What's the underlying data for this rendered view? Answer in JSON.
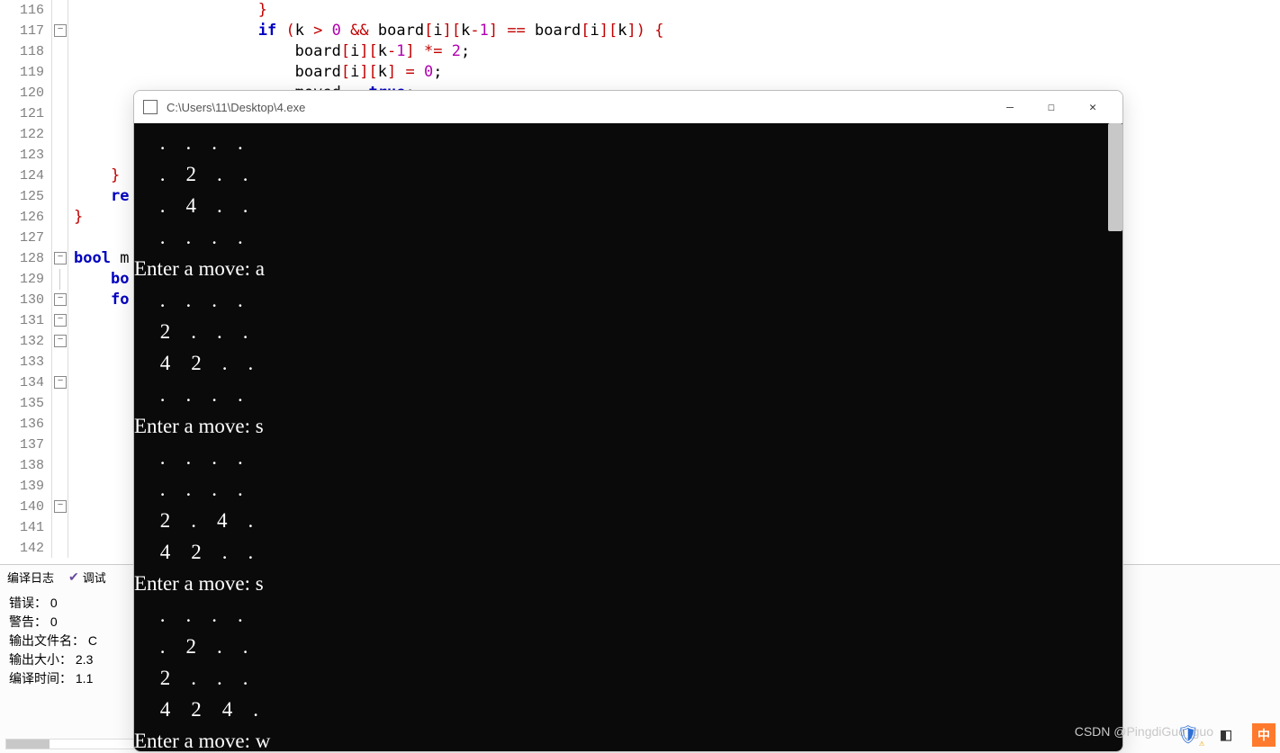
{
  "gutter": {
    "start": 116,
    "end": 142
  },
  "code_lines": [
    {
      "indent": 20,
      "html": "<span class='br'>}</span>"
    },
    {
      "indent": 20,
      "html": "<span class='kw'>if</span> <span class='br'>(</span>k <span class='op'>&gt;</span> <span class='num'>0</span> <span class='op'>&amp;&amp;</span> board<span class='br'>[</span>i<span class='br'>][</span>k<span class='op'>-</span><span class='num'>1</span><span class='br'>]</span> <span class='op'>==</span> board<span class='br'>[</span>i<span class='br'>][</span>k<span class='br'>]</span><span class='br'>)</span> <span class='br'>{</span>"
    },
    {
      "indent": 24,
      "html": "board<span class='br'>[</span>i<span class='br'>][</span>k<span class='op'>-</span><span class='num'>1</span><span class='br'>]</span> <span class='op'>*=</span> <span class='num'>2</span>;"
    },
    {
      "indent": 24,
      "html": "board<span class='br'>[</span>i<span class='br'>][</span>k<span class='br'>]</span> <span class='op'>=</span> <span class='num'>0</span>;"
    },
    {
      "indent": 24,
      "html": "moved <span class='op'>=</span> <span class='bool'>true</span>;"
    },
    {
      "indent": 0,
      "html": ""
    },
    {
      "indent": 0,
      "html": ""
    },
    {
      "indent": 0,
      "html": ""
    },
    {
      "indent": 4,
      "html": "<span class='br'>}</span>"
    },
    {
      "indent": 4,
      "html": "<span class='kw'>re</span>"
    },
    {
      "indent": 0,
      "html": "<span class='br'>}</span>"
    },
    {
      "indent": 0,
      "html": ""
    },
    {
      "indent": 0,
      "html": "<span class='kw'>bool</span> m"
    },
    {
      "indent": 4,
      "html": "<span class='kw'>bo</span>"
    },
    {
      "indent": 4,
      "html": "<span class='kw'>fo</span>"
    },
    {
      "indent": 0,
      "html": ""
    },
    {
      "indent": 0,
      "html": ""
    },
    {
      "indent": 0,
      "html": ""
    },
    {
      "indent": 0,
      "html": ""
    },
    {
      "indent": 0,
      "html": ""
    },
    {
      "indent": 0,
      "html": ""
    },
    {
      "indent": 0,
      "html": ""
    },
    {
      "indent": 0,
      "html": ""
    },
    {
      "indent": 0,
      "html": ""
    },
    {
      "indent": 0,
      "html": ""
    },
    {
      "indent": 0,
      "html": ""
    },
    {
      "indent": 0,
      "html": ""
    }
  ],
  "fold_markers": [
    "",
    "box",
    "",
    "",
    "",
    "",
    "",
    "",
    "",
    "",
    "",
    "",
    "box",
    "line",
    "box",
    "box",
    "box",
    "",
    "box",
    "",
    "",
    "",
    "",
    "",
    "box",
    "",
    ""
  ],
  "bottom_tabs": {
    "compile_log": "编译日志",
    "debug": "调试"
  },
  "bottom_output": {
    "errors_label": "错误：",
    "errors_value": "0",
    "warnings_label": "警告：",
    "warnings_value": "0",
    "outfile_label": "输出文件名：",
    "outfile_value": "C",
    "outsize_label": "输出大小：",
    "outsize_value": "2.3",
    "compiletime_label": "编译时间：",
    "compiletime_value": "1.1"
  },
  "console": {
    "title": "C:\\Users\\11\\Desktop\\4.exe",
    "lines": [
      "     .    .    .    .",
      "     .    2    .    .",
      "     .    4    .    .",
      "     .    .    .    .",
      "Enter a move: a",
      "     .    .    .    .",
      "     2    .    .    .",
      "     4    2    .    .",
      "     .    .    .    .",
      "Enter a move: s",
      "     .    .    .    .",
      "     .    .    .    .",
      "     2    .    4    .",
      "     4    2    .    .",
      "Enter a move: s",
      "     .    .    .    .",
      "     .    2    .    .",
      "     2    .    .    .",
      "     4    2    4    .",
      "Enter a move: w"
    ]
  },
  "watermark": "CSDN @PingdiGuo_guo"
}
